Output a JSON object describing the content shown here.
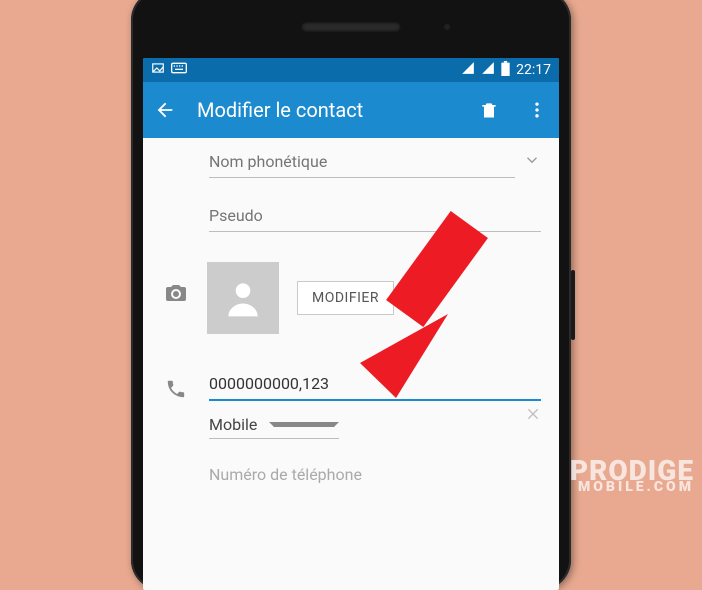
{
  "status": {
    "time": "22:17"
  },
  "header": {
    "title": "Modifier le contact"
  },
  "fields": {
    "phonetic_placeholder": "Nom phonétique",
    "pseudo_placeholder": "Pseudo",
    "modify_label": "MODIFIER",
    "phone_value": "0000000000,123",
    "type_value": "Mobile",
    "number_hint": "Numéro de téléphone"
  },
  "watermark": {
    "line1": "PRODIGE",
    "line2": "MOBILE.COM"
  },
  "colors": {
    "accent": "#1C8ACF",
    "bg": "#E8A990"
  }
}
